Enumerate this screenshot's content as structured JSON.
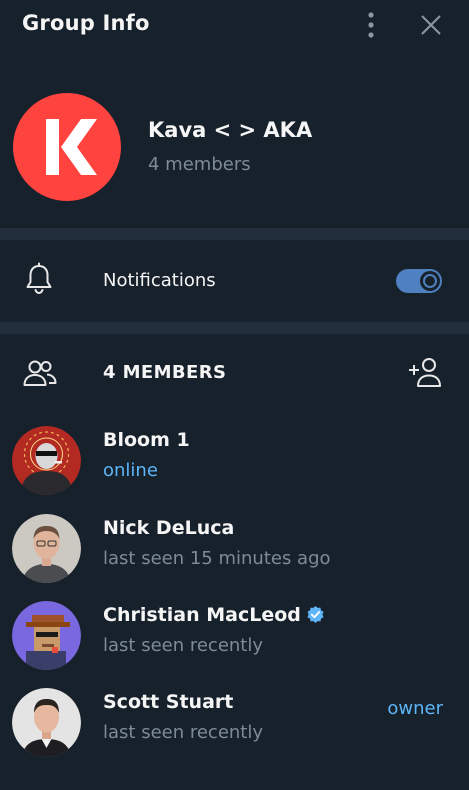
{
  "header": {
    "title": "Group Info",
    "more_icon": "more-vertical-icon",
    "close_icon": "close-icon"
  },
  "group": {
    "name": "Kava < > AKA",
    "member_count": "4 members",
    "avatar_color": "#ff433e"
  },
  "notifications": {
    "label": "Notifications",
    "enabled": true,
    "toggle_color": "#4f80c0"
  },
  "members": {
    "header_label": "4 MEMBERS",
    "items": [
      {
        "name": "Bloom 1",
        "status": "online",
        "role": "",
        "verified": false
      },
      {
        "name": "Nick DeLuca",
        "status": "last seen 15 minutes ago",
        "role": "",
        "verified": false
      },
      {
        "name": "Christian MacLeod",
        "status": "last seen recently",
        "role": "",
        "verified": true
      },
      {
        "name": "Scott Stuart",
        "status": "last seen recently",
        "role": "owner",
        "verified": false
      }
    ]
  },
  "colors": {
    "background": "#17212b",
    "divider": "#232e3c",
    "secondary_text": "#7d8b99",
    "accent": "#5eb5f7"
  }
}
